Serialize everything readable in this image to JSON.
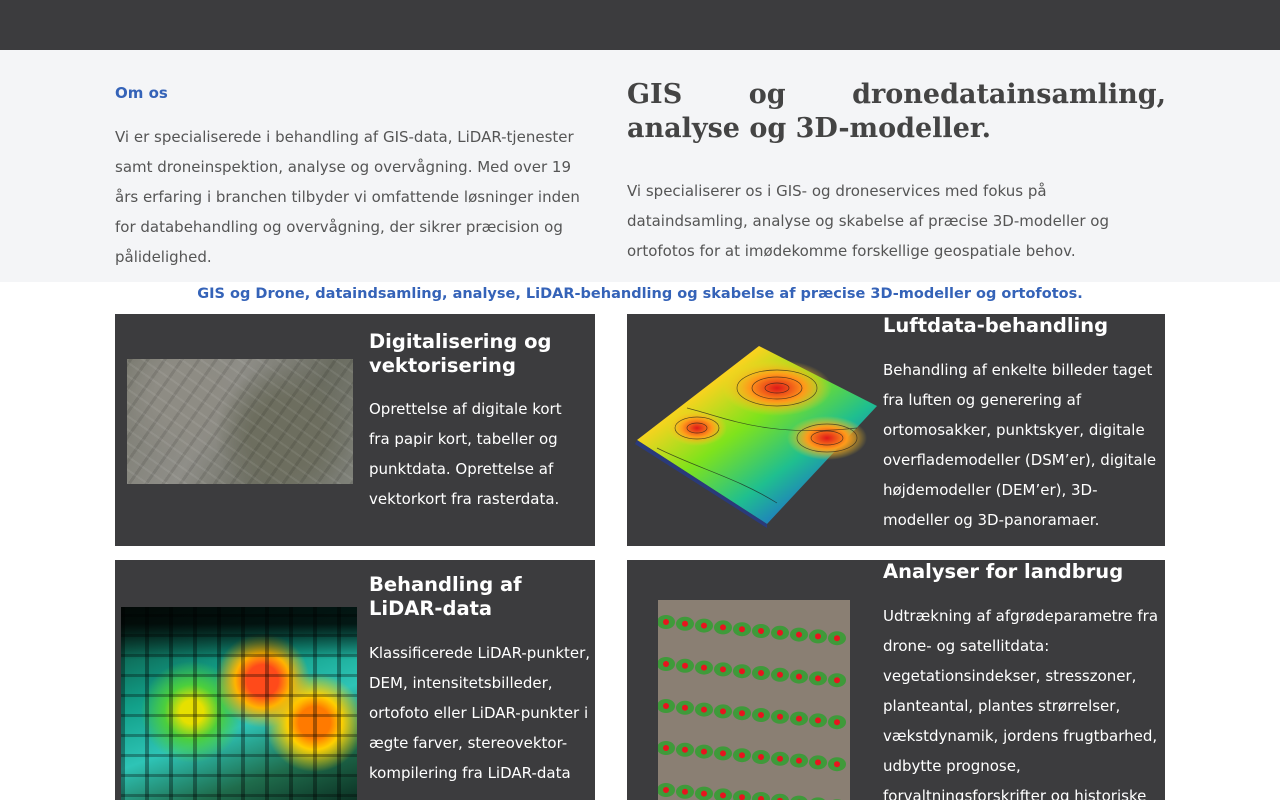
{
  "intro": {
    "om_title": "Om os",
    "om_text": "Vi er specialiserede i behandling af GIS-data, LiDAR-tjenester samt droneinspektion, analyse og overvågning. Med over 19 års erfaring i branchen tilbyder vi omfattende løsninger inden for databehandling og overvågning, der sikrer præcision og pålidelighed.",
    "headline": "GIS og dronedatainsamling, analyse og 3D-modeller.",
    "headline_text": "Vi specialiserer os i GIS- og droneservices med fokus på dataindsamling, analyse og skabelse af præcise 3D-modeller og ortofotos for at imødekomme forskellige geospatiale behov."
  },
  "tagline": "GIS og Drone, dataindsamling, analyse, LiDAR-behandling og skabelse af præcise 3D-modeller og ortofotos.",
  "cards": [
    {
      "title": "Digitalisering og vektorisering",
      "text": "Oprettelse af digitale kort fra papir kort, tabeller og punktdata. Oprettelse af vektorkort fra rasterdata.",
      "image": "satellite-map-image"
    },
    {
      "title": "Luftdata-behandling",
      "text": "Behandling af enkelte billeder taget fra luften og generering af ortomosakker, punktskyer, digitale overflademodeller (DSM’er), digitale højdemodeller (DEM’er), 3D-modeller og 3D-panoramaer.",
      "image": "terrain-elevation-model-image"
    },
    {
      "title": "Behandling af LiDAR-data",
      "text": "Klassificerede LiDAR-punkter, DEM, intensitetsbilleder, ortofoto eller LiDAR-punkter i ægte farver, stereovektor-kompilering fra LiDAR-data",
      "image": "lidar-city-pointcloud-image"
    },
    {
      "title": "Analyser for landbrug",
      "text": "Udtrækning af afgrødeparametre fra drone- og satellitdata: vegetationsindekser, stresszoner, planteantal, plantes strørrelser, vækstdynamik, jordens frugtbarhed, udbytte prognose, forvaltningsforskrifter og historiske",
      "image": "crop-rows-aerial-image"
    }
  ],
  "colors": {
    "accent": "#3563b8",
    "topbar": "#3c3c3e",
    "card_bg": "#3c3c3e",
    "intro_bg": "#f4f5f7"
  }
}
